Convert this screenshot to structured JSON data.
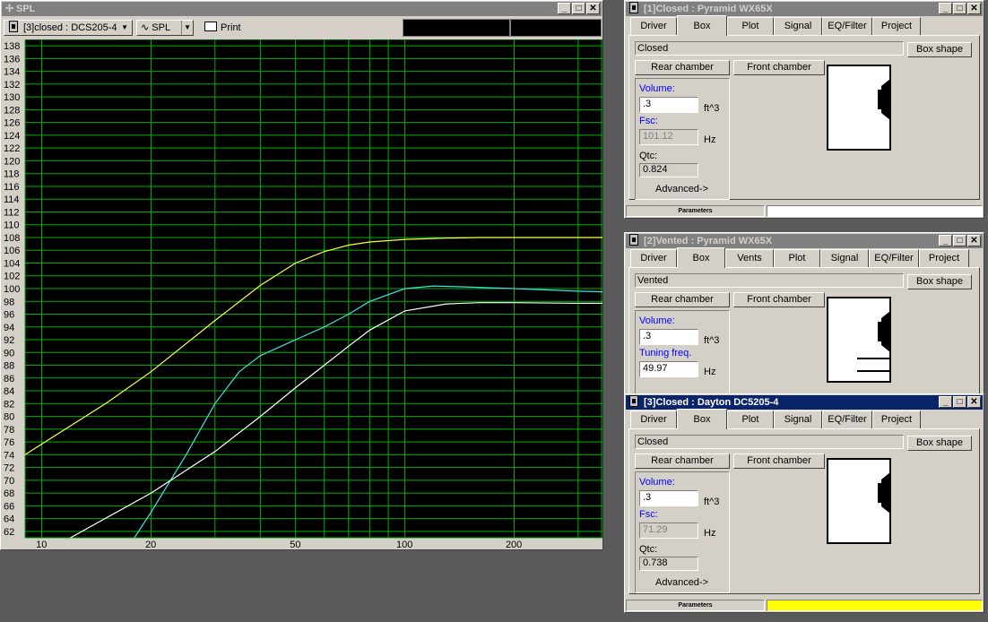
{
  "spl_window": {
    "title": "SPL",
    "toolbar": {
      "project_select": "[3]closed : DCS205-4",
      "graph_select": "SPL",
      "print_label": "Print"
    },
    "y_ticks": [
      "138",
      "136",
      "134",
      "132",
      "130",
      "128",
      "126",
      "124",
      "122",
      "120",
      "118",
      "116",
      "114",
      "112",
      "110",
      "108",
      "106",
      "104",
      "102",
      "100",
      "98",
      "96",
      "94",
      "92",
      "90",
      "88",
      "86",
      "84",
      "82",
      "80",
      "78",
      "76",
      "74",
      "72",
      "70",
      "68",
      "66",
      "64",
      "62"
    ],
    "x_ticks": [
      "10",
      "20",
      "50",
      "100",
      "200"
    ]
  },
  "chart_data": {
    "type": "line",
    "xscale": "log",
    "xlim": [
      9,
      350
    ],
    "ylim": [
      61,
      139
    ],
    "grid": true,
    "series": [
      {
        "color": "#ffff40",
        "x": [
          9,
          15,
          20,
          30,
          40,
          50,
          60,
          70,
          80,
          100,
          130,
          160,
          200,
          300,
          350
        ],
        "y": [
          74,
          82,
          87,
          95,
          100.5,
          104,
          105.8,
          106.8,
          107.3,
          107.7,
          107.9,
          108,
          108,
          108,
          108
        ]
      },
      {
        "color": "#40e0e0",
        "x": [
          18,
          20,
          25,
          30,
          35,
          40,
          50,
          60,
          70,
          80,
          100,
          120,
          140,
          200,
          300,
          350
        ],
        "y": [
          61,
          65,
          74,
          82,
          87,
          89.5,
          92,
          94,
          96,
          98,
          100,
          100.4,
          100.3,
          100,
          99.6,
          99.5
        ]
      },
      {
        "color": "#ffffff",
        "x": [
          12,
          20,
          30,
          40,
          50,
          60,
          70,
          80,
          100,
          130,
          160,
          200,
          300,
          350
        ],
        "y": [
          61,
          68,
          74.5,
          80,
          84.5,
          88,
          91,
          93.5,
          96.5,
          97.6,
          97.8,
          97.8,
          97.7,
          97.7
        ]
      }
    ]
  },
  "panels": [
    {
      "title": "[1]Closed : Pyramid WX65X",
      "tabs": [
        "Driver",
        "Box",
        "Plot",
        "Signal",
        "EQ/Filter",
        "Project"
      ],
      "selected_tab": "Box",
      "box_type": "Closed",
      "box_shape_label": "Box shape",
      "rear_chamber_label": "Rear chamber",
      "front_chamber_label": "Front chamber",
      "volume_label": "Volume:",
      "volume_value": ".3",
      "volume_unit": "ft^3",
      "second_label": "Fsc:",
      "second_value": "101.12",
      "second_unit": "Hz",
      "qtc_label": "Qtc:",
      "qtc_value": "0.824",
      "advanced_label": "Advanced->",
      "status_label": "Parameters",
      "status_fill": "#ffffff"
    },
    {
      "title": "[2]Vented : Pyramid WX65X",
      "tabs": [
        "Driver",
        "Box",
        "Vents",
        "Plot",
        "Signal",
        "EQ/Filter",
        "Project"
      ],
      "selected_tab": "Box",
      "box_type": "Vented",
      "box_shape_label": "Box shape",
      "rear_chamber_label": "Rear chamber",
      "front_chamber_label": "Front chamber",
      "volume_label": "Volume:",
      "volume_value": ".3",
      "volume_unit": "ft^3",
      "second_label": "Tuning freq.",
      "second_value": "49.97",
      "second_unit": "Hz"
    },
    {
      "title": "[3]Closed : Dayton DC5205-4",
      "tabs": [
        "Driver",
        "Box",
        "Plot",
        "Signal",
        "EQ/Filter",
        "Project"
      ],
      "selected_tab": "Box",
      "box_type": "Closed",
      "box_shape_label": "Box shape",
      "rear_chamber_label": "Rear chamber",
      "front_chamber_label": "Front chamber",
      "volume_label": "Volume:",
      "volume_value": ".3",
      "volume_unit": "ft^3",
      "second_label": "Fsc:",
      "second_value": "71.29",
      "second_unit": "Hz",
      "qtc_label": "Qtc:",
      "qtc_value": "0.738",
      "advanced_label": "Advanced->",
      "status_label": "Parameters",
      "status_fill": "#ffff00"
    }
  ]
}
